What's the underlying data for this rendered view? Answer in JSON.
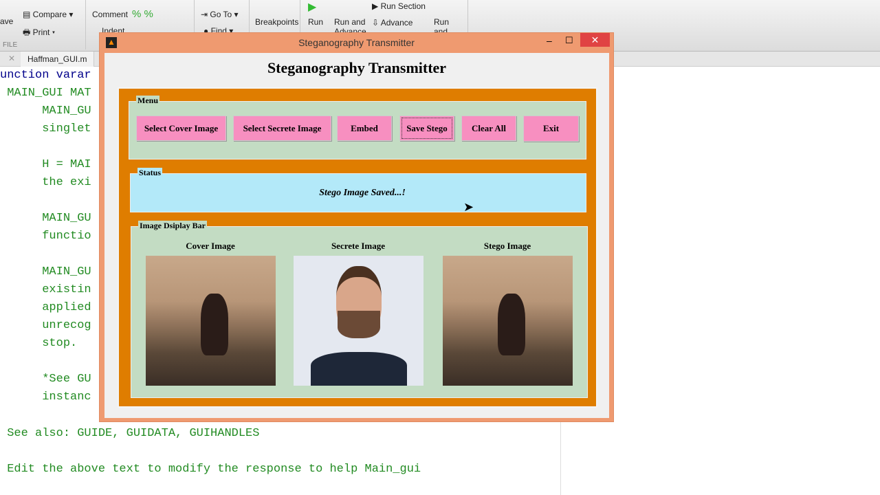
{
  "editor": {
    "toolbar": {
      "save": "ave",
      "compare": "Compare",
      "print": "Print",
      "comment": "Comment",
      "indent": "Indent",
      "goto": "Go To",
      "find": "Find",
      "breakpoints": "Breakpoints",
      "run": "Run",
      "run_advance": "Run and Advance",
      "run_section": "Run Section",
      "advance": "Advance",
      "run_time": "Run and Time",
      "file_section": "FILE"
    },
    "tab": "Haffman_GUI.m",
    "code_lines": [
      "unction varar",
      " MAIN_GUI MAT",
      "      MAIN_GU",
      "      singlet",
      "",
      "      H = MAI",
      "      the exi",
      "",
      "      MAIN_GU",
      "      functio",
      "",
      "      MAIN_GU",
      "      existin",
      "      applied",
      "      unrecog",
      "      stop.",
      "",
      "      *See GU",
      "      instanc"
    ],
    "see_also": " See also: GUIDE, GUIDATA, GUIHANDLES",
    "edit_line": " Edit the above text to modify the response to help Main_gui"
  },
  "window": {
    "title": "Steganography Transmitter",
    "heading": "Steganography Transmitter",
    "menu": {
      "label": "Menu",
      "buttons": [
        "Select Cover Image",
        "Select Secrete Image",
        "Embed",
        "Save Stego",
        "Clear All",
        "Exit"
      ]
    },
    "status": {
      "label": "Status",
      "text": "Stego Image Saved...!"
    },
    "images": {
      "label": "Image Dsiplay Bar",
      "captions": [
        "Cover Image",
        "Secrete Image",
        "Stego Image"
      ]
    }
  },
  "colors": {
    "title_bar": "#ef9a70",
    "frame": "#df7d00",
    "panel": "#c3dcc3",
    "status": "#b3e9f9",
    "button": "#f78fc0"
  }
}
